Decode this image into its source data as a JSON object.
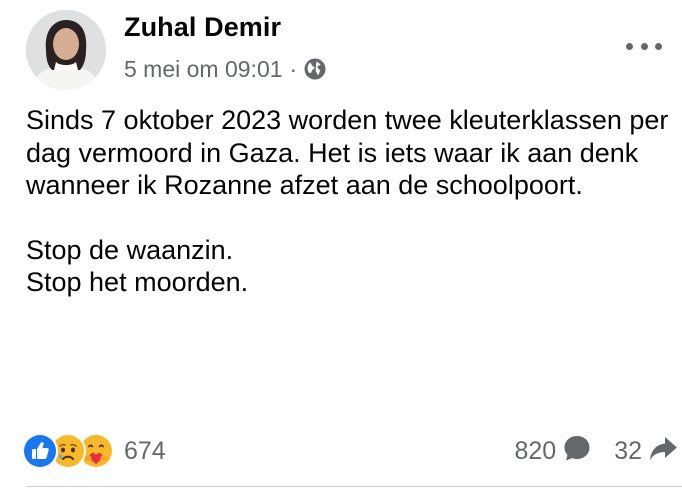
{
  "post": {
    "author": "Zuhal Demir",
    "timestamp": "5 mei om 09:01",
    "separator": "·",
    "audience_icon": "globe-icon",
    "body": {
      "paragraph1": "Sinds 7 oktober 2023 worden twee kleuterklassen per dag vermoord in Gaza. Het is iets waar ik aan denk wanneer ik Rozanne afzet aan de schoolpoort.",
      "line2": "Stop de waanzin.",
      "line3": "Stop het moorden."
    }
  },
  "reactions": {
    "icons": [
      "like-icon",
      "sad-icon",
      "care-icon"
    ],
    "count": "674"
  },
  "comments": {
    "count": "820",
    "icon": "comment-icon"
  },
  "shares": {
    "count": "32",
    "icon": "share-icon"
  },
  "colors": {
    "like_blue": "#1877f2",
    "reaction_yellow": "#f7b928",
    "secondary_text": "#65676b",
    "primary_text": "#050505"
  }
}
